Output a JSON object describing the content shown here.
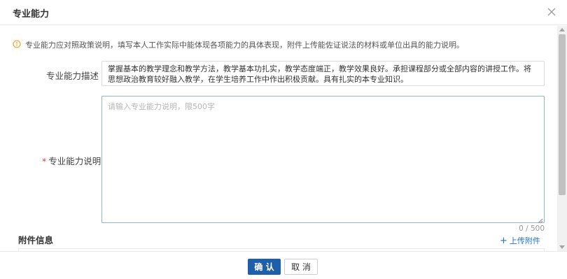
{
  "dialog": {
    "title": "专业能力"
  },
  "notice": {
    "text": "专业能力应对照政策说明，填写本人工作实际中能体现各项能力的具体表现，附件上传能佐证说法的材料或单位出具的能力说明。",
    "icon": "warning-circle-icon",
    "color": "#f0a020"
  },
  "form": {
    "description_label": "专业能力描述",
    "description_text": "掌握基本的教学理念和教学方法，教学基本功扎实，教学态度端正，教学效果良好。承担课程部分或全部内容的讲授工作。将思想政治教育较好融入教学，在学生培养工作中作出积极贡献。具有扎实的本专业知识。",
    "explanation_label": "专业能力说明",
    "required_mark": "*",
    "explanation_value": "",
    "explanation_placeholder": "请输入专业能力说明，限500字",
    "counter": "0 / 500"
  },
  "attachments": {
    "section_title": "附件信息",
    "upload_label": "上传附件",
    "upload_icon": "plus-icon"
  },
  "footer": {
    "confirm_label": "确 认",
    "cancel_label": "取 消"
  },
  "colors": {
    "primary": "#1d5fa8",
    "link": "#1e6fc6",
    "required": "#e53935"
  }
}
